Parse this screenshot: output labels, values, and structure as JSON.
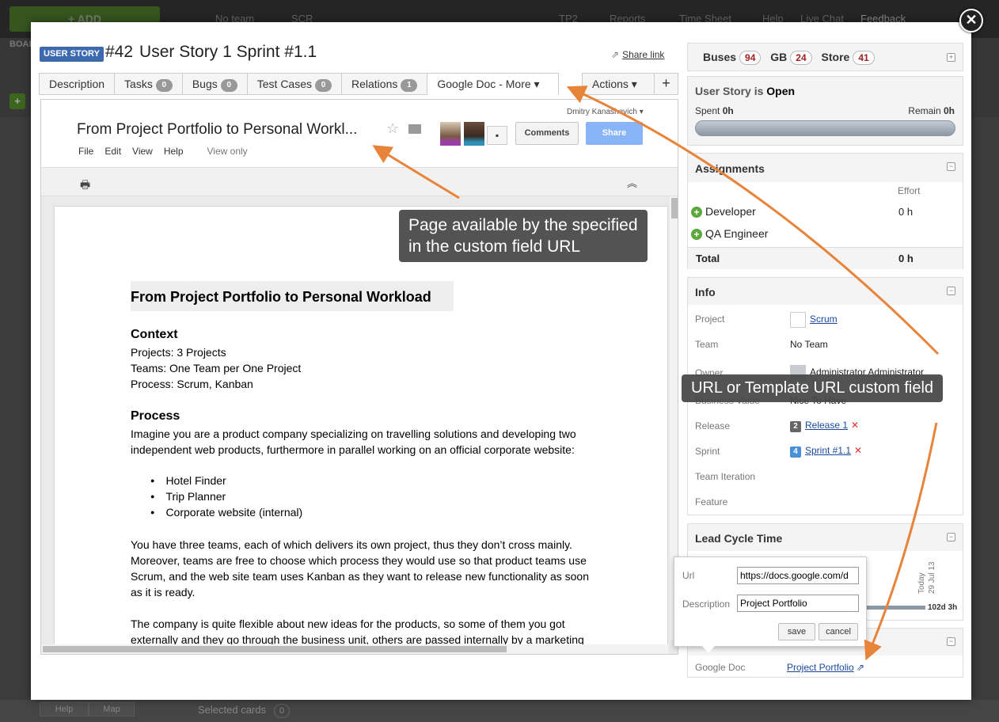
{
  "background": {
    "add_label": "+ ADD",
    "team_label": "No team",
    "scr_label": "SCR",
    "tp2_label": "TP2",
    "reports_label": "Reports",
    "timesheet_label": "Time Sheet",
    "help_label": "Help",
    "livechat_label": "Live Chat",
    "feedback_label": "Feedback",
    "board_label": "BOAR",
    "help_btn": "Help",
    "map_btn": "Map",
    "selected_cards_label": "Selected cards",
    "selected_cards_count": "0"
  },
  "entity": {
    "type_badge": "USER STORY",
    "id": "#42",
    "name": "User Story 1 Sprint #1.1",
    "share_link": "Share link"
  },
  "tabs": [
    {
      "label": "Description"
    },
    {
      "label": "Tasks",
      "count": "0"
    },
    {
      "label": "Bugs",
      "count": "0"
    },
    {
      "label": "Test Cases",
      "count": "0"
    },
    {
      "label": "Relations",
      "count": "1"
    },
    {
      "label": "Google Doc - More ▾"
    }
  ],
  "actions_label": "Actions ▾",
  "add_tab_label": "+",
  "gdoc": {
    "title": "From Project Portfolio to Personal Workl...",
    "user": "Dmitry Kanashevich ▾",
    "menu": [
      "File",
      "Edit",
      "View",
      "Help"
    ],
    "view_only": "View only",
    "comments_btn": "Comments",
    "share_btn": "Share",
    "heading": "From Project Portfolio to Personal Workload",
    "context_heading": "Context",
    "context_lines": [
      "Projects: 3 Projects",
      "Teams: One Team per One Project",
      "Process: Scrum, Kanban"
    ],
    "process_heading": "Process",
    "process_lines": [
      "Imagine you are a product company specializing on travelling solutions and developing two",
      "independent web products, furthermore in parallel working on an official corporate website:"
    ],
    "list": [
      "Hotel Finder",
      "Trip Planner",
      "Corporate website (internal)"
    ],
    "para2": [
      "You have three teams, each of which delivers its own project, thus they don’t cross mainly.",
      "Moreover, teams are free to choose which process they would use so that product teams use",
      "Scrum, and the web site team uses Kanban as they want to release new functionality as soon",
      "as it is ready."
    ],
    "para3": [
      "The company is quite flexible about new ideas for the products, so some of them you got",
      "externally and they go through the business unit, others are passed internally by a marketing"
    ]
  },
  "callouts": {
    "page_available": [
      "Page available by the specified",
      "in the custom field URL"
    ],
    "url_field": "URL or Template URL custom field"
  },
  "counters": [
    {
      "label": "Buses",
      "value": "94"
    },
    {
      "label": "GB",
      "value": "24"
    },
    {
      "label": "Store",
      "value": "41"
    }
  ],
  "state": {
    "prefix": "User Story is",
    "status": "Open",
    "spent_label": "Spent",
    "spent_value": "0h",
    "remain_label": "Remain",
    "remain_value": "0h"
  },
  "assignments": {
    "title": "Assignments",
    "effort_header": "Effort",
    "rows": [
      {
        "role": "Developer",
        "effort": "0 h"
      },
      {
        "role": "QA Engineer",
        "effort": ""
      }
    ],
    "total_label": "Total",
    "total_value": "0 h"
  },
  "info": {
    "title": "Info",
    "project_label": "Project",
    "project_value": "Scrum",
    "team_label": "Team",
    "team_value": "No Team",
    "owner_label": "Owner",
    "owner_value": "Administrator Administrator",
    "business_value_label": "Business Value",
    "business_value": "Nice To Have",
    "release_label": "Release",
    "release_num": "2",
    "release_value": "Release 1",
    "sprint_label": "Sprint",
    "sprint_num": "4",
    "sprint_value": "Sprint #1.1",
    "team_iteration_label": "Team Iteration",
    "feature_label": "Feature"
  },
  "lead_cycle": {
    "title": "Lead Cycle Time",
    "today_label": "Today",
    "date_label": "29 Jul 13",
    "duration": "102d 3h"
  },
  "custom_field": {
    "label": "Google Doc",
    "value": "Project Portfolio"
  },
  "popup": {
    "url_label": "Url",
    "url_value": "https://docs.google.com/d",
    "desc_label": "Description",
    "desc_value": "Project Portfolio",
    "save": "save",
    "cancel": "cancel"
  },
  "colors": {
    "badge": "#3d6aae",
    "arrow": "#e8843a",
    "link": "#1a4a9a",
    "share_button": "#8ab4f8"
  }
}
